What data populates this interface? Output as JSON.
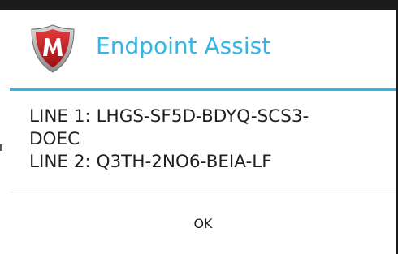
{
  "dialog": {
    "title": "Endpoint Assist",
    "icon": "mcafee-shield-icon",
    "message_lines": [
      "LINE 1: LHGS-SF5D-BDYQ-SCS3-",
      "DOEC",
      "LINE 2: Q3TH-2NO6-BEIA-LF"
    ],
    "ok_label": "OK"
  },
  "colors": {
    "accent": "#33b5e5",
    "shield_red": "#c8202a",
    "background": "#ffffff",
    "text": "#1f1f1f",
    "status_bar": "#1c1c1c"
  }
}
